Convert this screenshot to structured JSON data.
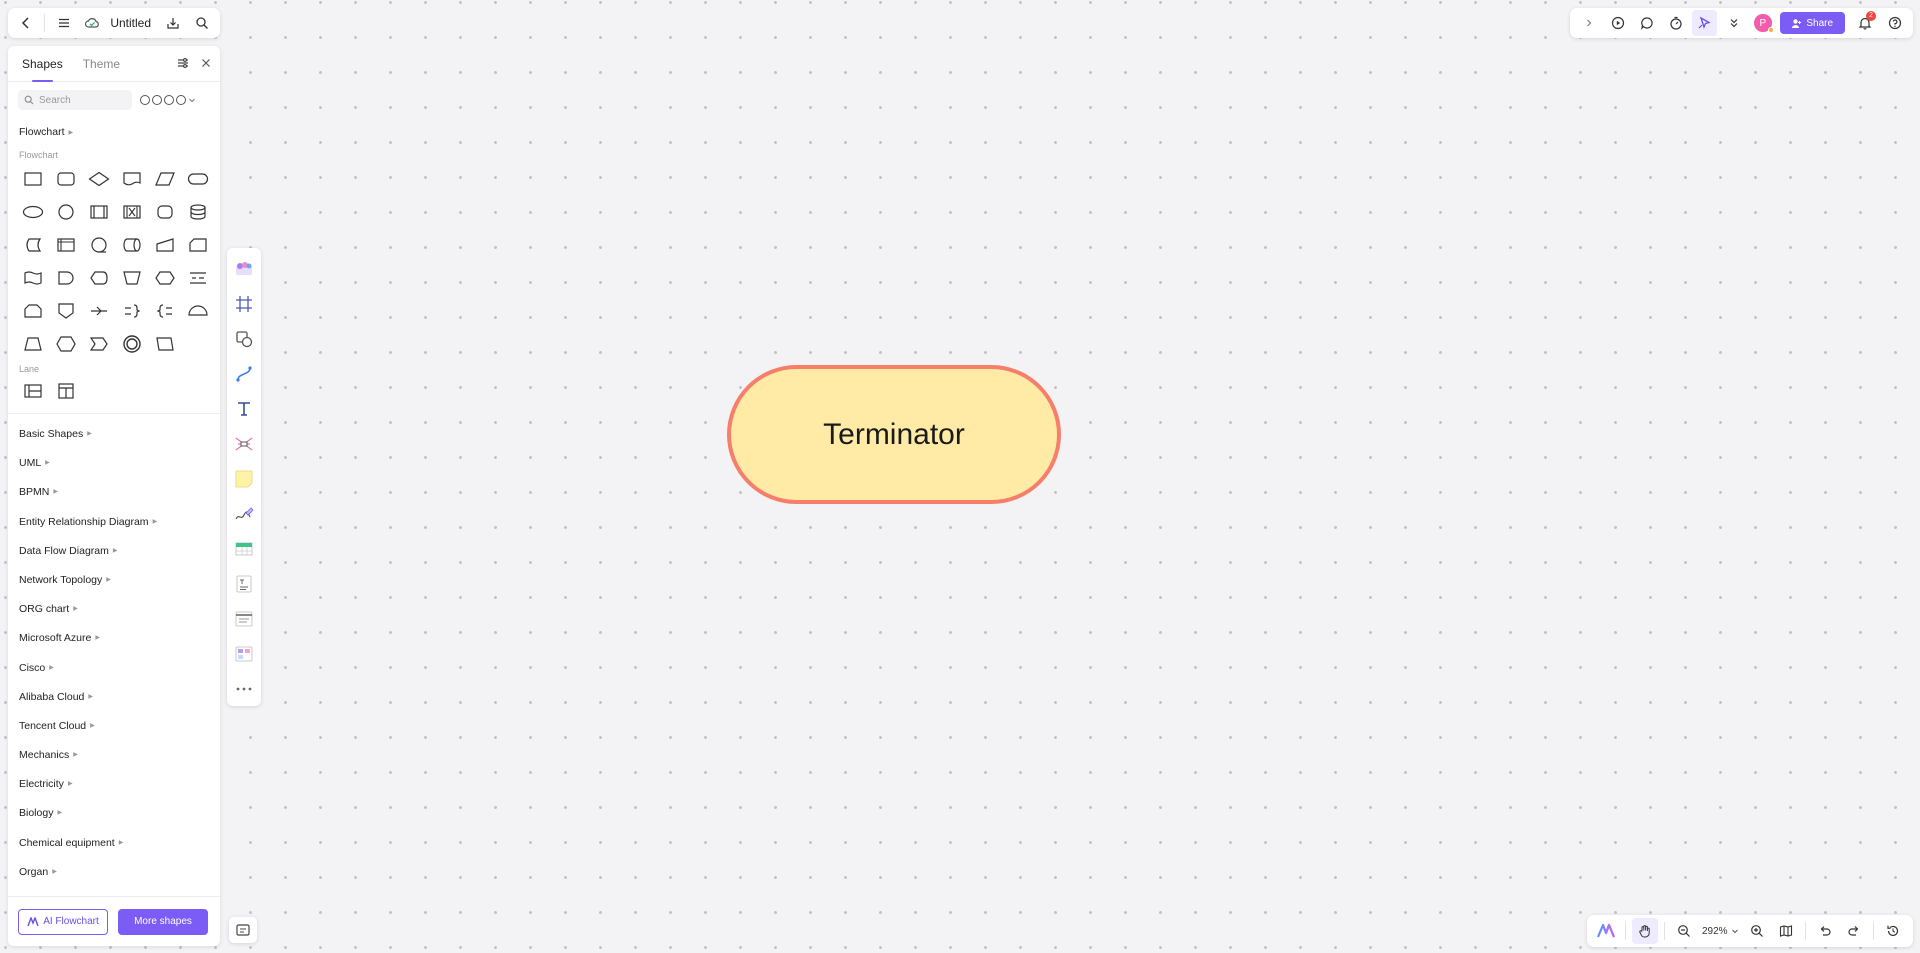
{
  "header": {
    "title": "Untitled"
  },
  "panel": {
    "tabs": [
      {
        "label": "Shapes"
      },
      {
        "label": "Theme"
      }
    ],
    "search": {
      "placeholder": "Search",
      "value": ""
    },
    "library": "Flowchart",
    "sections": {
      "flowchart": "Flowchart",
      "lane": "Lane"
    },
    "categories": [
      {
        "label": "Basic Shapes"
      },
      {
        "label": "UML"
      },
      {
        "label": "BPMN"
      },
      {
        "label": "Entity Relationship Diagram"
      },
      {
        "label": "Data Flow Diagram"
      },
      {
        "label": "Network Topology"
      },
      {
        "label": "ORG chart"
      },
      {
        "label": "Microsoft Azure"
      },
      {
        "label": "Cisco"
      },
      {
        "label": "Alibaba Cloud"
      },
      {
        "label": "Tencent Cloud"
      },
      {
        "label": "Mechanics"
      },
      {
        "label": "Electricity"
      },
      {
        "label": "Biology"
      },
      {
        "label": "Chemical equipment"
      },
      {
        "label": "Organ"
      }
    ],
    "footer": {
      "ai_label": "AI Flowchart",
      "more_label": "More shapes"
    }
  },
  "canvas": {
    "shape_text": "Terminator",
    "fill_color": "#ffeba6",
    "stroke_color": "#f67e6a"
  },
  "topbar": {
    "avatar_initial": "P",
    "share_label": "Share",
    "notification_count": "2"
  },
  "zoom": {
    "value": "292%"
  },
  "colors": {
    "accent": "#7b5cf5",
    "canvas_bg": "#f3f2f5"
  }
}
